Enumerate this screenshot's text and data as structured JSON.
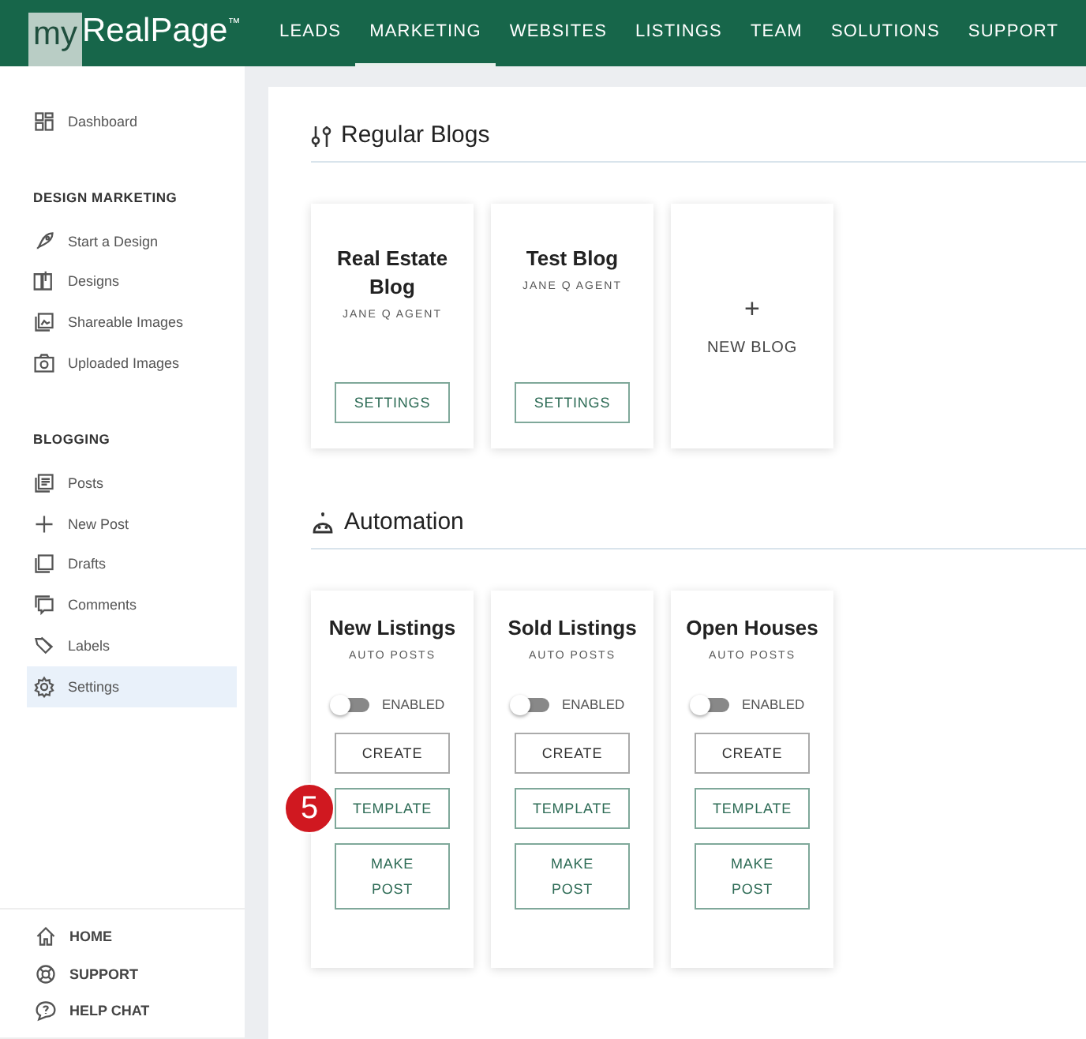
{
  "header": {
    "logo": {
      "prefix": "my",
      "name": "RealPage",
      "mark": "™"
    },
    "nav": [
      {
        "label": "LEADS",
        "selected": false
      },
      {
        "label": "MARKETING",
        "selected": true
      },
      {
        "label": "WEBSITES",
        "selected": false
      },
      {
        "label": "LISTINGS",
        "selected": false
      },
      {
        "label": "TEAM",
        "selected": false
      },
      {
        "label": "SOLUTIONS",
        "selected": false
      },
      {
        "label": "SUPPORT",
        "selected": false
      }
    ]
  },
  "sidebar": {
    "groups": [
      {
        "items": [
          {
            "label": "Dashboard",
            "selected": false
          }
        ]
      },
      {
        "title": "DESIGN MARKETING",
        "items": [
          {
            "label": "Start a Design",
            "selected": false
          },
          {
            "label": "Designs",
            "selected": false
          },
          {
            "label": "Shareable Images",
            "selected": false
          },
          {
            "label": "Uploaded Images",
            "selected": false
          }
        ]
      },
      {
        "title": "BLOGGING",
        "items": [
          {
            "label": "Posts",
            "selected": false
          },
          {
            "label": "New Post",
            "selected": false
          },
          {
            "label": "Drafts",
            "selected": false
          },
          {
            "label": "Comments",
            "selected": false
          },
          {
            "label": "Labels",
            "selected": false
          },
          {
            "label": "Settings",
            "selected": true
          }
        ]
      }
    ],
    "footer": [
      "HOME",
      "SUPPORT",
      "HELP CHAT"
    ]
  },
  "regular_blogs": {
    "title": "Regular Blogs",
    "cards": [
      {
        "kind": "blog",
        "title": "Real Estate Blog",
        "owner": "JANE Q AGENT",
        "button": "SETTINGS"
      },
      {
        "kind": "blog",
        "title": "Test Blog",
        "owner": "JANE Q AGENT",
        "button": "SETTINGS"
      },
      {
        "kind": "add",
        "symbol": "+",
        "label": "NEW BLOG"
      }
    ]
  },
  "automation": {
    "title": "Automation",
    "cards": [
      {
        "title": "New Listings",
        "subtitle": "AUTO POSTS",
        "toggle": {
          "label": "ENABLED",
          "on": false
        },
        "buttons": [
          "CREATE",
          "TEMPLATE",
          "MAKE POST"
        ],
        "callout": "5"
      },
      {
        "title": "Sold Listings",
        "subtitle": "AUTO POSTS",
        "toggle": {
          "label": "ENABLED",
          "on": false
        },
        "buttons": [
          "CREATE",
          "TEMPLATE",
          "MAKE POST"
        ]
      },
      {
        "title": "Open Houses",
        "subtitle": "AUTO POSTS",
        "toggle": {
          "label": "ENABLED",
          "on": false
        },
        "buttons": [
          "CREATE",
          "TEMPLATE",
          "MAKE POST"
        ]
      }
    ]
  }
}
